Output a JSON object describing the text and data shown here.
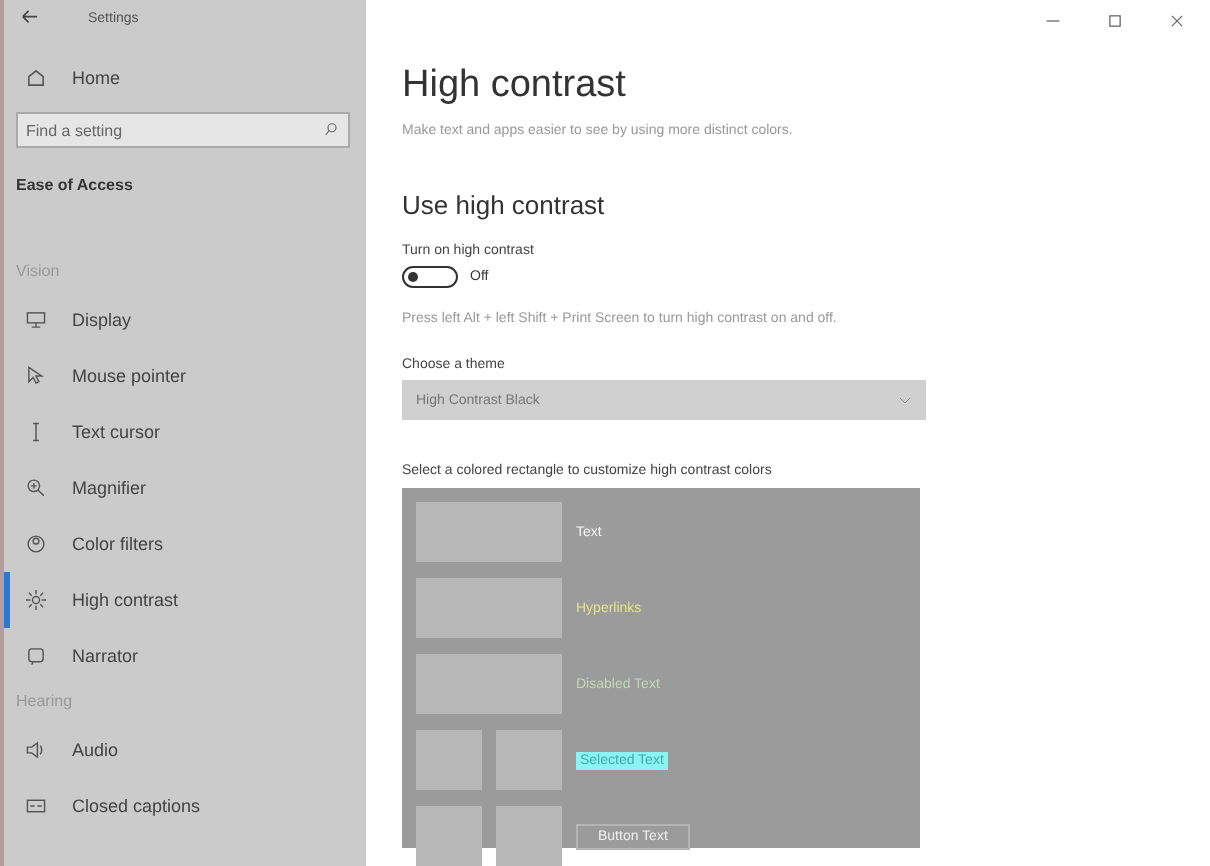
{
  "window": {
    "title": "Settings"
  },
  "sidebar": {
    "home": "Home",
    "search": {
      "placeholder": "Find a setting"
    },
    "category": "Ease of Access",
    "groups": [
      {
        "heading": "Vision",
        "items": [
          {
            "label": "Display",
            "selected": false
          },
          {
            "label": "Mouse pointer",
            "selected": false
          },
          {
            "label": "Text cursor",
            "selected": false
          },
          {
            "label": "Magnifier",
            "selected": false
          },
          {
            "label": "Color filters",
            "selected": false
          },
          {
            "label": "High contrast",
            "selected": true
          },
          {
            "label": "Narrator",
            "selected": false
          }
        ]
      },
      {
        "heading": "Hearing",
        "items": [
          {
            "label": "Audio",
            "selected": false
          },
          {
            "label": "Closed captions",
            "selected": false
          }
        ]
      }
    ]
  },
  "main": {
    "title": "High contrast",
    "description": "Make text and apps easier to see by using more distinct colors.",
    "section": "Use high contrast",
    "toggle": {
      "label": "Turn on high contrast",
      "on": false,
      "state_text": "Off"
    },
    "hint": "Press left Alt + left Shift + Print Screen to turn high contrast on and off.",
    "theme": {
      "label": "Choose a theme",
      "value": "High Contrast Black",
      "disabled": true
    },
    "preview_label": "Select a colored rectangle to customize high contrast colors",
    "preview": [
      {
        "kind": "wide",
        "label": "Text",
        "color": "#f4f4f4"
      },
      {
        "kind": "wide",
        "label": "Hyperlinks",
        "color": "#e4e48c"
      },
      {
        "kind": "wide",
        "label": "Disabled Text",
        "color": "#c4d8b4"
      },
      {
        "kind": "split",
        "label": "Selected Text",
        "color": "#8cf4f4"
      },
      {
        "kind": "button",
        "label": "Button Text",
        "color": "#b4b4b4"
      }
    ]
  }
}
